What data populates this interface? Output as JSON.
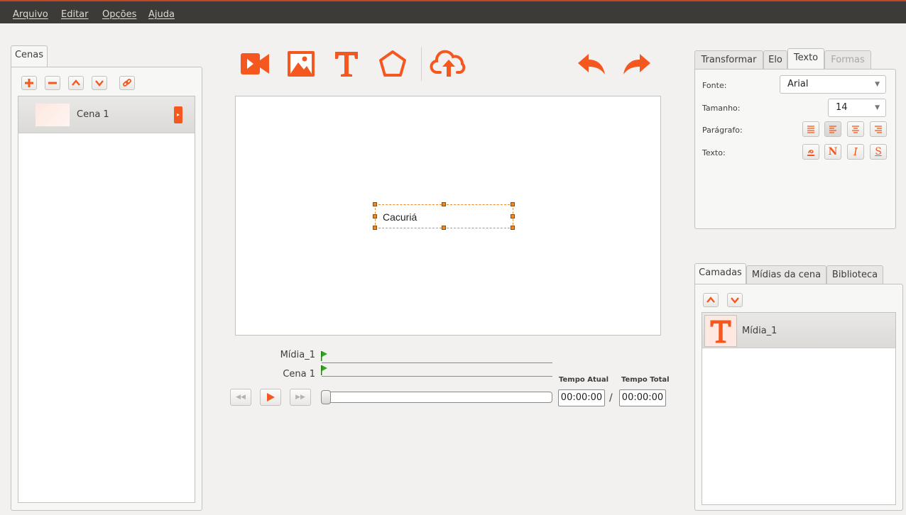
{
  "menu": {
    "items": [
      "Arquivo",
      "Editar",
      "Opções",
      "Ajuda"
    ]
  },
  "colors": {
    "accent": "#f5581f",
    "menubar": "#3c3b37",
    "window_bg": "#f2f1f0"
  },
  "scenes_panel": {
    "tab_label": "Cenas",
    "toolbar_icons": [
      "plus-icon",
      "minus-icon",
      "chevron-up-icon",
      "chevron-down-icon",
      "link-icon"
    ],
    "items": [
      {
        "name": "Cena 1"
      }
    ]
  },
  "main_toolbar": {
    "icons": [
      "video-icon",
      "image-icon",
      "text-icon",
      "pentagon-icon",
      "cloud-upload-icon",
      "undo-icon",
      "redo-icon"
    ]
  },
  "canvas": {
    "text_element": "Cacuriá"
  },
  "timeline": {
    "tracks": [
      {
        "label": "Mídia_1"
      },
      {
        "label": "Cena 1"
      }
    ],
    "current_time_label": "Tempo Atual",
    "total_time_label": "Tempo Total",
    "current_time": "00:00:00",
    "separator": "/",
    "total_time": "00:00:00",
    "controls": [
      "rewind-icon",
      "play-icon",
      "fast-forward-icon"
    ]
  },
  "properties": {
    "tabs": [
      "Transformar",
      "Elo",
      "Texto",
      "Formas"
    ],
    "active_tab": "Texto",
    "font_label": "Fonte:",
    "font_value": "Arial",
    "size_label": "Tamanho:",
    "size_value": "14",
    "paragraph_label": "Parágrafo:",
    "text_label": "Texto:",
    "text_style_buttons": [
      "N",
      "I",
      "S"
    ]
  },
  "layers_panel": {
    "tabs": [
      "Camadas",
      "Mídias da cena",
      "Biblioteca"
    ],
    "active_tab": "Camadas",
    "items": [
      {
        "name": "Mídia_1",
        "icon": "T"
      }
    ]
  }
}
